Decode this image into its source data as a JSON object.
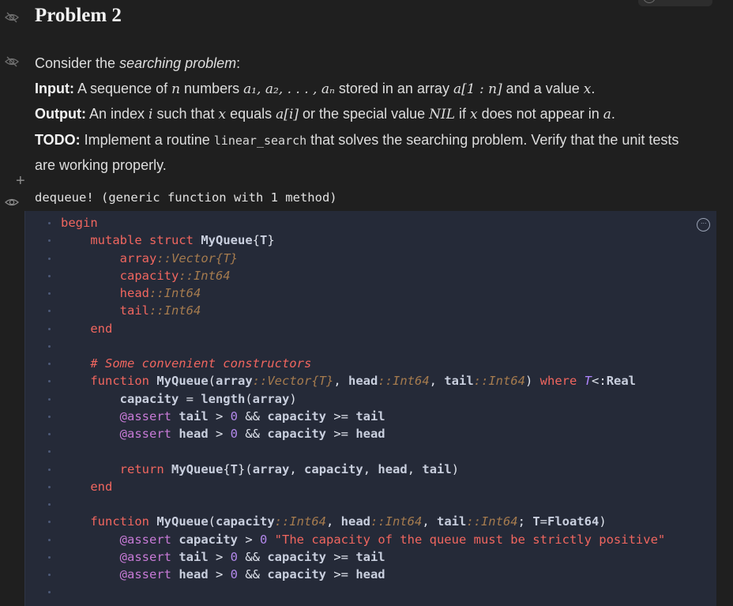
{
  "header": {
    "title": "Problem 2"
  },
  "markdown": {
    "intro_text": "Consider the ",
    "intro_italic": "searching problem",
    "intro_end": ":",
    "input_label": "Input:",
    "input_text_1": " A sequence of ",
    "input_math_n": "n",
    "input_text_2": " numbers ",
    "input_math_seq": "a₁, a₂, . . . , aₙ",
    "input_text_3": " stored in an array ",
    "input_math_arr": "a[1 : n]",
    "input_text_4": " and a value ",
    "input_math_x": "x",
    "input_text_5": ".",
    "output_label": "Output:",
    "output_text_1": " An index ",
    "output_math_i": "i",
    "output_text_2": " such that ",
    "output_math_x": "x",
    "output_text_3": " equals ",
    "output_math_ai": "a[i]",
    "output_text_4": " or the special value ",
    "output_math_nil": "NIL",
    "output_text_5": " if ",
    "output_math_x2": "x",
    "output_text_6": " does not appear in ",
    "output_math_a": "a",
    "output_text_7": ".",
    "todo_label": "TODO:",
    "todo_text_1": " Implement a routine ",
    "todo_code": "linear_search",
    "todo_text_2": " that solves the searching problem. Verify that the unit tests are working properly."
  },
  "cell_output": "dequeue! (generic function with 1 method)",
  "code_cell": {
    "more_label": "···"
  },
  "colors": {
    "background": "#1f1f1f",
    "code_background": "#252a38",
    "keyword": "#f0665f",
    "type": "#a57b4e",
    "number": "#b388eb",
    "macro": "#c77ad6"
  },
  "icons": [
    "eye-slash-icon",
    "eye-slash-icon",
    "eye-icon",
    "plus-icon",
    "more-options-icon"
  ]
}
